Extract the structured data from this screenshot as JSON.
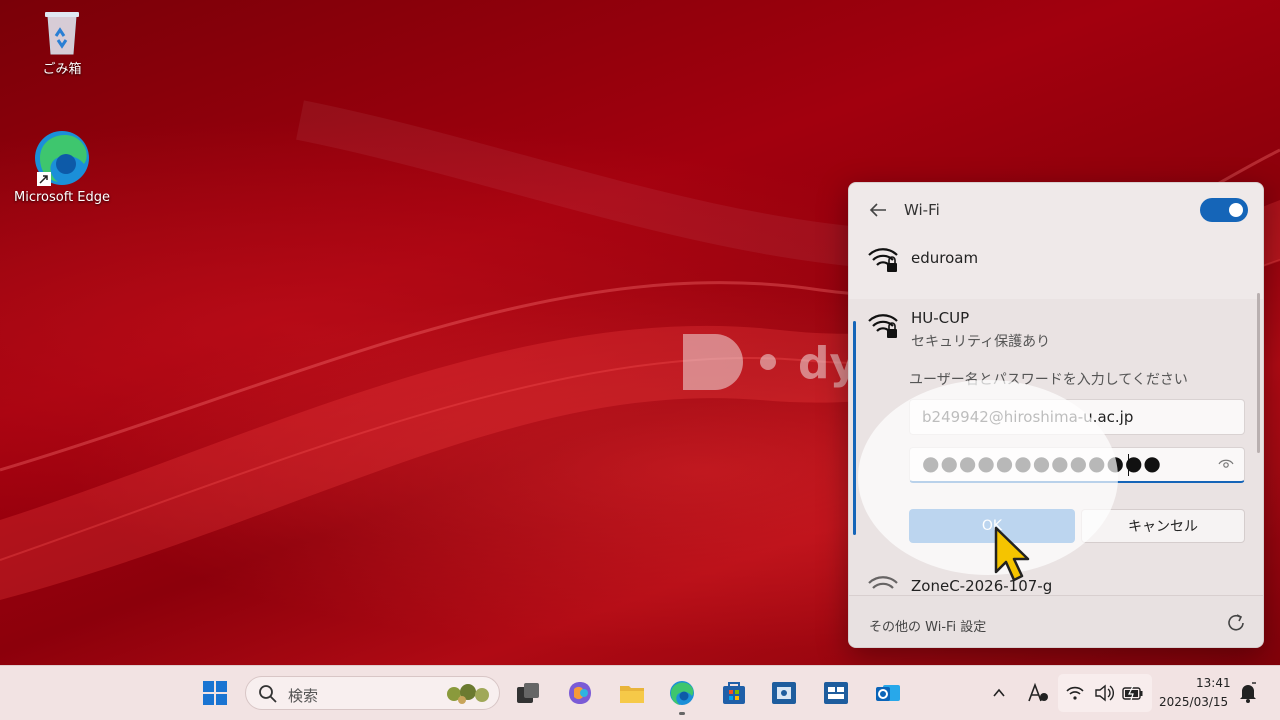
{
  "desktop": {
    "icons": [
      {
        "label": "ごみ箱",
        "icon": "recycle-bin-icon"
      },
      {
        "label": "Microsoft Edge",
        "icon": "edge-icon"
      }
    ],
    "logo_text": "dy"
  },
  "wifi_panel": {
    "title": "Wi-Fi",
    "toggle_on": true,
    "networks": [
      {
        "name": "eduroam",
        "icon": "wifi-secured-icon"
      },
      {
        "name": "HU-CUP",
        "status": "セキュリティ保護あり",
        "prompt": "ユーザー名とパスワードを入力してください",
        "username_value": "b249942@hiroshima-u.ac.jp",
        "password_value": "●●●●●●●●●●●●●",
        "ok_label": "OK",
        "cancel_label": "キャンセル"
      },
      {
        "name": "ZoneC-2026-107-g",
        "icon": "wifi-secured-icon"
      }
    ],
    "footer_link": "その他の Wi-Fi 設定"
  },
  "taskbar": {
    "search_placeholder": "検索",
    "time": "13:41",
    "date": "2025/03/15",
    "pinned": [
      "start-icon",
      "task-view-icon",
      "copilot-icon",
      "file-explorer-icon",
      "edge-icon",
      "store-icon",
      "app-1-icon",
      "app-2-icon",
      "outlook-icon"
    ]
  },
  "colors": {
    "accent": "#1565b8",
    "ok_button": "#1f74c8",
    "wallpaper": "#a2000e",
    "cursor": "#f5c400"
  }
}
